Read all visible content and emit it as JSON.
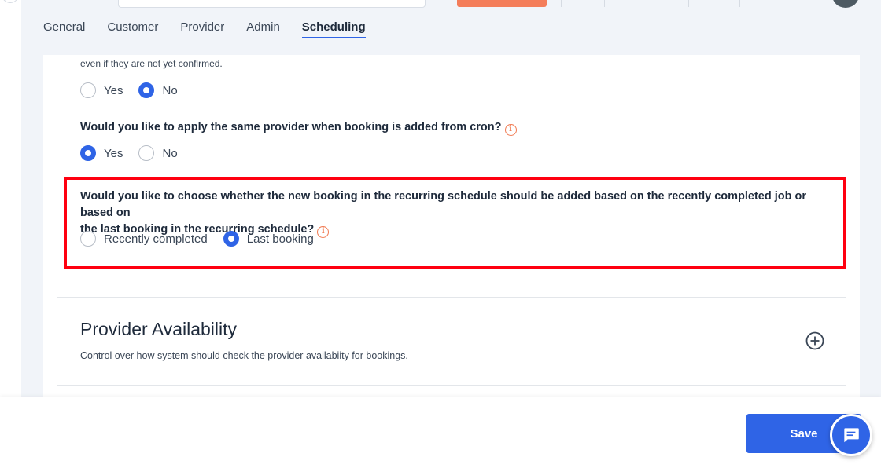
{
  "tabs": [
    {
      "label": "General",
      "active": false
    },
    {
      "label": "Customer",
      "active": false
    },
    {
      "label": "Provider",
      "active": false
    },
    {
      "label": "Admin",
      "active": false
    },
    {
      "label": "Scheduling",
      "active": true
    }
  ],
  "settings": {
    "note": "even if they are not yet confirmed.",
    "q1": {
      "options": [
        {
          "label": "Yes",
          "selected": false
        },
        {
          "label": "No",
          "selected": true
        }
      ]
    },
    "q2": {
      "question": "Would you like to apply the same provider when booking is added from cron?",
      "options": [
        {
          "label": "Yes",
          "selected": true
        },
        {
          "label": "No",
          "selected": false
        }
      ]
    },
    "q3": {
      "question_line1": "Would you like to choose whether the new booking in the recurring schedule should be added based on the recently completed job or based on",
      "question_line2": "the last booking in the recurring schedule?",
      "options": [
        {
          "label": "Recently completed",
          "selected": false
        },
        {
          "label": "Last booking",
          "selected": true
        }
      ]
    }
  },
  "provider_availability": {
    "title": "Provider Availability",
    "description": "Control over how system should check the provider availabiity for bookings."
  },
  "footer": {
    "save_label": "Save"
  },
  "colors": {
    "accent": "#2f64e6",
    "info": "#f0784f",
    "highlight": "#ff0010"
  },
  "icons": {
    "info": "info-icon",
    "expand": "plus-circle-icon",
    "chat": "chat-icon"
  }
}
